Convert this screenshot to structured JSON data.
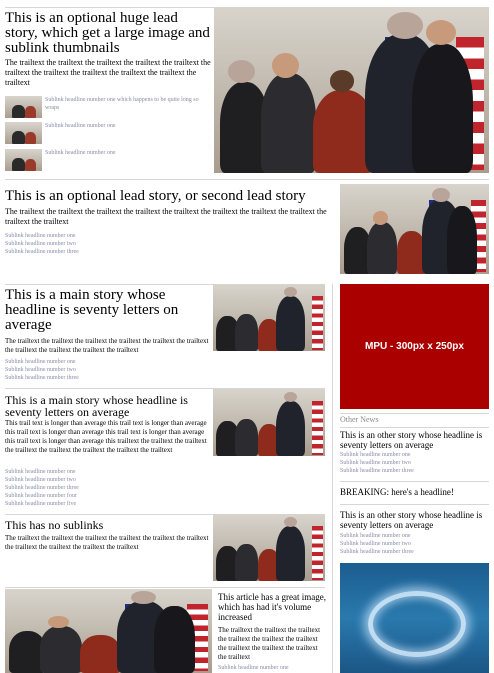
{
  "lead1": {
    "headline": "This is an optional huge lead story, which get a large image and sublink thumbnails",
    "trailtext": "The trailtext the trailtext the trailtext the trailtext the trailtext the trailtext the trailtext the trailtext the trailtext the trailtext the trailtext",
    "sublinks": [
      "Sublink headline number one which happens to be quite long so wraps",
      "Sublink headline number one",
      "Sublink headline number one"
    ]
  },
  "lead2": {
    "headline": "This is an optional lead story, or second lead story",
    "trailtext": "The trailtext the trailtext the trailtext the trailtext the trailtext the trailtext the trailtext the trailtext the trailtext the trailtext",
    "sublinks": [
      "Sublink headline number one",
      "Sublink headline number two",
      "Sublink headline number three"
    ]
  },
  "story1": {
    "headline": "This is a main story whose headline is seventy letters on average",
    "trailtext": "The trailtext the trailtext the trailtext the trailtext the trailtext the trailtext the trailtext the trailtext the trailtext the trailtext",
    "sublinks": [
      "Sublink headline number one",
      "Sublink headline number two",
      "Sublink headline number three"
    ]
  },
  "story2": {
    "headline": "This is a main story whose headline is seventy letters on average",
    "trailtext": "This trail text is longer than average this trail text is longer than average this trail text is longer than average this trail text is longer than average this trail text is longer than average this trailtext the trailtext the trailtext the trailtext the trailtext the trailtext the trailtext the trailtext",
    "sublinks": [
      "Sublink headline number one",
      "Sublink headline number two",
      "Sublink headline number three",
      "Sublink headline number four",
      "Sublink headline number five"
    ]
  },
  "story3": {
    "headline": "This has no sublinks",
    "trailtext": "The trailtext the trailtext the trailtext the trailtext the trailtext the trailtext the trailtext the trailtext the trailtext the trailtext"
  },
  "story4": {
    "headline": "This article has a great image, which has had it's volume increased",
    "trailtext": "The trailtext the trailtext the trailtext the trailtext the trailtext the trailtext the trailtext the trailtext the trailtext the trailtext",
    "sublinks": [
      "Sublink headline number one"
    ]
  },
  "mpu": {
    "label": "MPU - 300px x 250px",
    "color": "#aa0000"
  },
  "other": {
    "heading": "Other News",
    "items": [
      {
        "headline": "This is an other story whose headline is seventy letters on average",
        "sublinks": [
          "Sublink headline number one",
          "Sublink headline number two",
          "Sublink headline number three"
        ]
      },
      {
        "headline": "BREAKING: here's a headline!",
        "sublinks": []
      },
      {
        "headline": "This is an other story whose headline is seventy letters on average",
        "sublinks": [
          "Sublink headline number one",
          "Sublink headline number two",
          "Sublink headline number three"
        ]
      }
    ]
  }
}
